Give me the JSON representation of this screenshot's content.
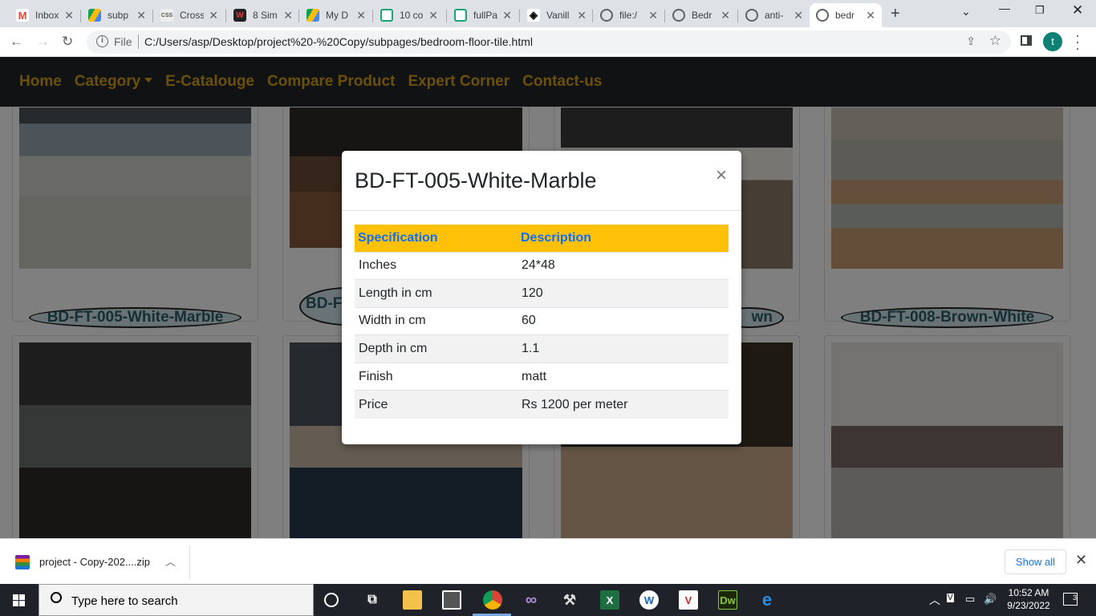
{
  "browser": {
    "tabs": [
      {
        "title": "Inbox",
        "icon": "gmail-icon"
      },
      {
        "title": "subp",
        "icon": "drive-icon"
      },
      {
        "title": "Cross",
        "icon": "css3-icon"
      },
      {
        "title": "8 Sim",
        "icon": "w-icon"
      },
      {
        "title": "My D",
        "icon": "drive-icon"
      },
      {
        "title": "10 co",
        "icon": "page-icon"
      },
      {
        "title": "fullPa",
        "icon": "page-icon"
      },
      {
        "title": "Vanill",
        "icon": "codepen-icon"
      },
      {
        "title": "file:/",
        "icon": "globe-icon"
      },
      {
        "title": "Bedr",
        "icon": "globe-icon"
      },
      {
        "title": "anti-",
        "icon": "globe-icon"
      },
      {
        "title": "bedr",
        "icon": "globe-icon"
      }
    ],
    "file_label": "File",
    "url": "C:/Users/asp/Desktop/project%20-%20Copy/subpages/bedroom-floor-tile.html",
    "profile_initial": "t"
  },
  "navbar": {
    "items": [
      "Home",
      "Category",
      "E-Catalouge",
      "Compare Product",
      "Expert Corner",
      "Contact-us"
    ],
    "color": "#d4a017"
  },
  "products": {
    "row1": [
      "BD-FT-005-White-Marble",
      "BD-FT",
      "wn",
      "BD-FT-008-Brown-White"
    ]
  },
  "modal": {
    "title": "BD-FT-005-White-Marble",
    "close": "×",
    "headers": [
      "Specification",
      "Description"
    ],
    "rows": [
      [
        "Inches",
        "24*48"
      ],
      [
        "Length in cm",
        "120"
      ],
      [
        "Width in cm",
        "60"
      ],
      [
        "Depth in cm",
        "1.1"
      ],
      [
        "Finish",
        "matt"
      ],
      [
        "Price",
        "Rs 1200 per meter"
      ]
    ],
    "header_bg": "#ffc107",
    "header_text": "#0d6efd"
  },
  "download": {
    "filename": "project - Copy-202....zip",
    "show_all": "Show all"
  },
  "taskbar": {
    "search_placeholder": "Type here to search",
    "time": "10:52 AM",
    "date": "9/23/2022",
    "notifications": "3"
  }
}
